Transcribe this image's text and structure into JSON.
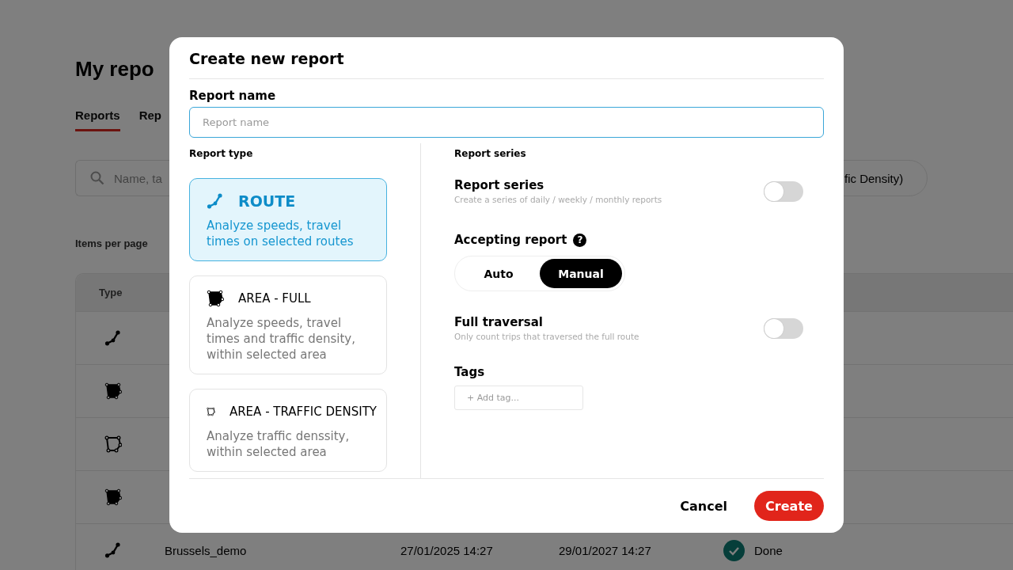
{
  "background": {
    "title": "My repo",
    "tabs": [
      {
        "label": "Reports",
        "selected": true
      },
      {
        "label": "Rep",
        "selected": false
      }
    ],
    "search": {
      "placeholder": "Name, ta"
    },
    "filter_chip": "fic Density)",
    "items_per_page_label": "Items per page",
    "table": {
      "columns": [
        "Type"
      ],
      "rows": [
        {
          "kind": "route"
        },
        {
          "kind": "area_full"
        },
        {
          "kind": "area_density"
        },
        {
          "kind": "area_full"
        },
        {
          "kind": "route",
          "name": "Brussels_demo",
          "column_3": "27/01/2025 14:27",
          "column_4": "29/01/2027 14:27",
          "status": "Done"
        }
      ]
    }
  },
  "dialog": {
    "title": "Create new report",
    "report_name": {
      "label": "Report name",
      "placeholder": "Report name"
    },
    "report_type": {
      "label": "Report type",
      "cards": [
        {
          "kind": "route",
          "title": "ROUTE",
          "description": "Analyze speeds, travel times on selected routes",
          "selected": true
        },
        {
          "kind": "area_full",
          "title": "AREA - FULL",
          "description": "Analyze speeds, travel times and traffic density, within selected area",
          "selected": false
        },
        {
          "kind": "area_density",
          "title": "AREA - TRAFFIC DENSITY",
          "description": "Analyze traffic denssity, within selected area",
          "selected": false
        }
      ]
    },
    "report_series": {
      "section_label": "Report series",
      "title": "Report series",
      "subtitle": "Create a series of daily / weekly / monthly reports",
      "on": false
    },
    "accepting_report": {
      "label": "Accepting report",
      "help_icon": "?",
      "options": [
        {
          "label": "Auto",
          "selected": false
        },
        {
          "label": "Manual",
          "selected": true
        }
      ]
    },
    "full_traversal": {
      "title": "Full traversal",
      "subtitle": "Only count trips that traversed the full route",
      "on": false
    },
    "tags": {
      "label": "Tags",
      "placeholder": "+ Add tag..."
    },
    "buttons": {
      "cancel": "Cancel",
      "create": "Create"
    }
  }
}
